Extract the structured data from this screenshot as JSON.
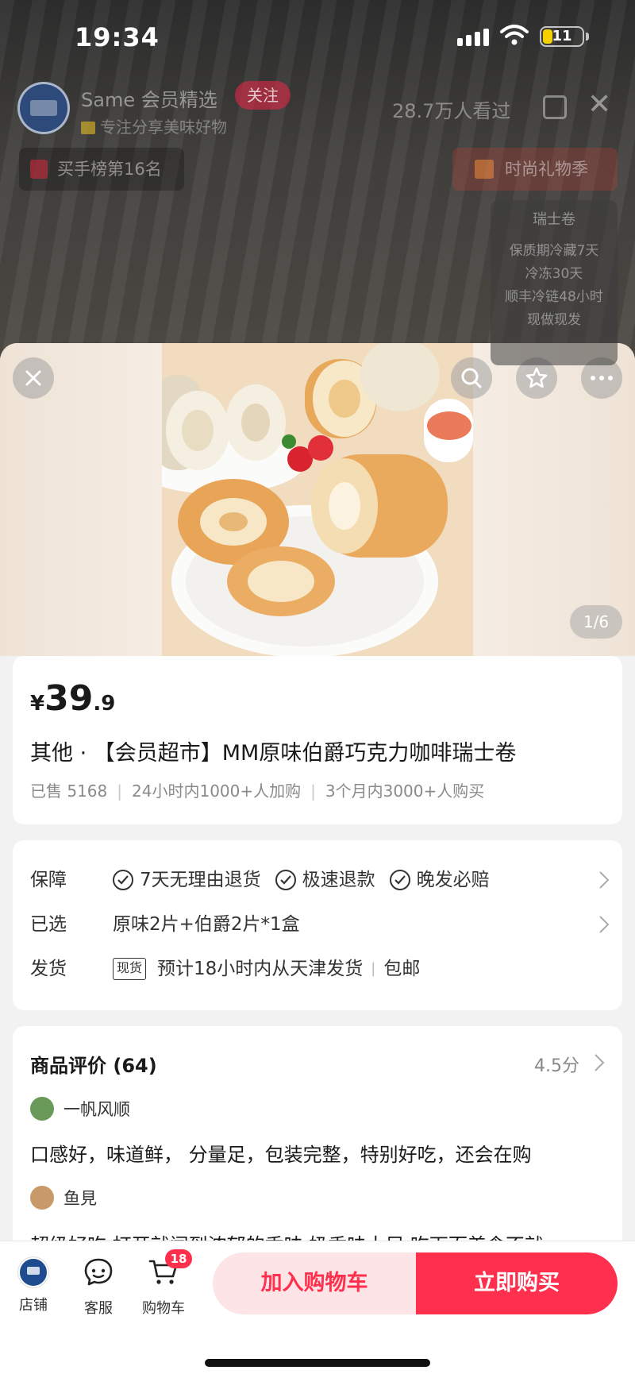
{
  "status_bar": {
    "time": "19:34",
    "battery": "11"
  },
  "live": {
    "host_name": "Same 会员精选",
    "follow_label": "关注",
    "host_desc": "专注分享美味好物",
    "viewer_count": "28.7万人看过",
    "rank_label": "买手榜第16名",
    "rank_sub": "",
    "gift_label": "时尚礼物季",
    "info_card": {
      "title": "瑞士卷",
      "lines": [
        "保质期冷藏7天",
        "冷冻30天",
        "顺丰冷链48小时",
        "现做现发"
      ]
    }
  },
  "gallery": {
    "counter": "1/6"
  },
  "product": {
    "currency": "¥",
    "price_int": "39",
    "price_dec": ".9",
    "title": "其他 · 【会员超市】MM原味伯爵巧克力咖啡瑞士卷",
    "sold": "已售 5168",
    "added_24h": "24小时内1000+人加购",
    "bought_3m": "3个月内3000+人购买"
  },
  "services": {
    "guarantee_label": "保障",
    "guarantees": [
      "7天无理由退货",
      "极速退款",
      "晚发必赔"
    ],
    "selected_label": "已选",
    "selected_value": "原味2片+伯爵2片*1盒",
    "shipping_label": "发货",
    "stock_tag": "现货",
    "shipping_value": "预计18小时内从天津发货",
    "shipping_extra": "包邮"
  },
  "reviews": {
    "title": "商品评价 (64)",
    "score": "4.5分",
    "items": [
      {
        "user": "一帆风顺",
        "text": "口感好，味道鲜， 分量足，包装完整，特别好吃，还会在购"
      },
      {
        "user": "鱼見",
        "text": "超级好吃 打开就闻到浓郁的香味 奶香味十足 吃下而美食不就"
      }
    ]
  },
  "action_bar": {
    "store_label": "店铺",
    "service_label": "客服",
    "cart_label": "购物车",
    "cart_count": "18",
    "add_to_cart": "加入购物车",
    "buy_now": "立即购买"
  },
  "colors": {
    "accent": "#ff2f4e",
    "accent_light": "#fde5e7"
  },
  "icons": [
    "close-icon",
    "search-icon",
    "star-icon",
    "more-icon",
    "check-circle-icon",
    "chevron-right-icon",
    "store-icon",
    "chat-icon",
    "cart-icon"
  ]
}
